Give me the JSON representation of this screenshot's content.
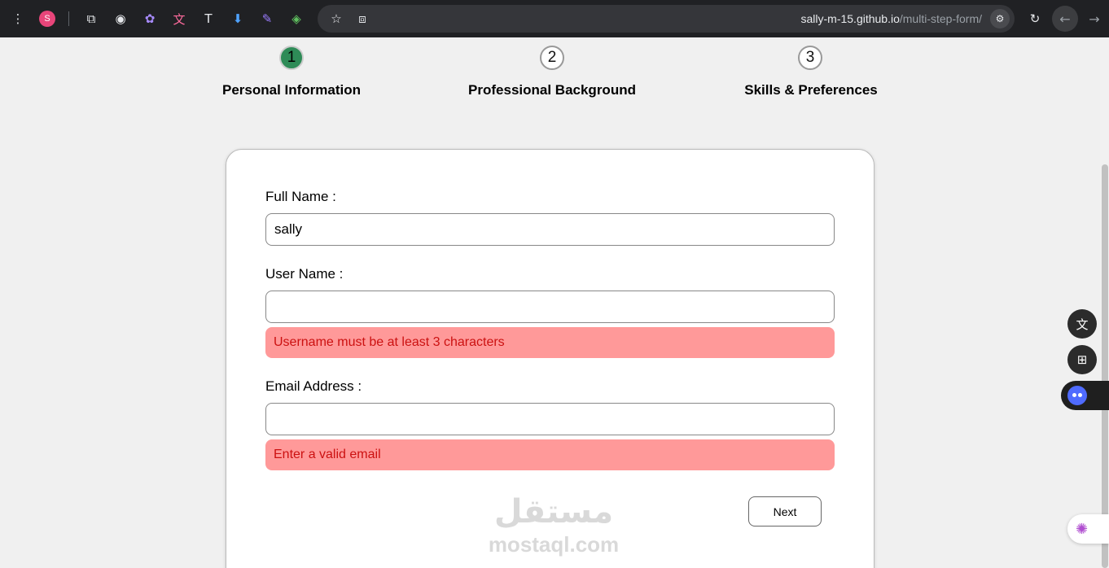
{
  "browser": {
    "profile_initial": "S",
    "url_host": "sally-m-15.github.io",
    "url_path": "/multi-step-form/",
    "extension_glyphs": [
      "⧉",
      "◉",
      "✿",
      "文",
      "T",
      "⬇",
      "✎",
      "◈"
    ],
    "menu_glyph": "⋮",
    "star_glyph": "☆",
    "install_glyph": "⧈",
    "tune_glyph": "⚙",
    "reload_glyph": "↻",
    "back_glyph": "←",
    "forward_glyph": "→"
  },
  "steps": [
    {
      "number": "1",
      "label": "Personal Information",
      "active": true
    },
    {
      "number": "2",
      "label": "Professional Background",
      "active": false
    },
    {
      "number": "3",
      "label": "Skills & Preferences",
      "active": false
    }
  ],
  "form": {
    "full_name": {
      "label": "Full Name :",
      "value": "sally"
    },
    "user_name": {
      "label": "User Name :",
      "value": "",
      "error": "Username must be at least 3 characters"
    },
    "email": {
      "label": "Email Address :",
      "value": "",
      "error": "Enter a valid email"
    },
    "next_label": "Next"
  },
  "watermark": {
    "arabic": "مستقل",
    "latin": "mostaql.com"
  },
  "widgets": {
    "translate_glyph": "文",
    "apps_glyph": "⊞",
    "brain_glyph": "✺"
  },
  "colors": {
    "active_step": "#2e8b57",
    "error_bg": "#ff9999",
    "error_text": "#cc1111"
  }
}
